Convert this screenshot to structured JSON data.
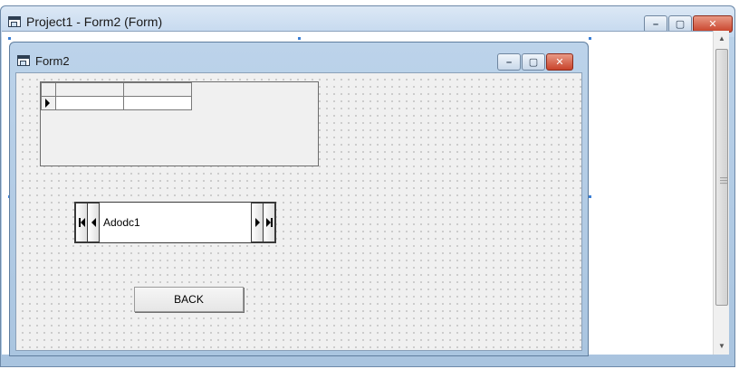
{
  "outer_window": {
    "title": "Project1 - Form2 (Form)",
    "icon": "form-window-icon",
    "controls": {
      "minimize": "minimize-icon",
      "maximize": "maximize-icon",
      "close": "close-icon"
    }
  },
  "form": {
    "title": "Form2",
    "icon": "form-window-icon",
    "controls": {
      "minimize": "minimize-icon",
      "maximize": "maximize-icon",
      "close": "close-icon"
    }
  },
  "adodc": {
    "caption": "Adodc1",
    "buttons": [
      "move-first-icon",
      "move-previous-icon",
      "move-next-icon",
      "move-last-icon"
    ]
  },
  "back_button": {
    "label": "BACK"
  },
  "colors": {
    "title_bar": "#c2d7ee",
    "close_button": "#c8432b",
    "form_background": "#f0f0f0",
    "selection_handle": "#3b7fd6"
  }
}
